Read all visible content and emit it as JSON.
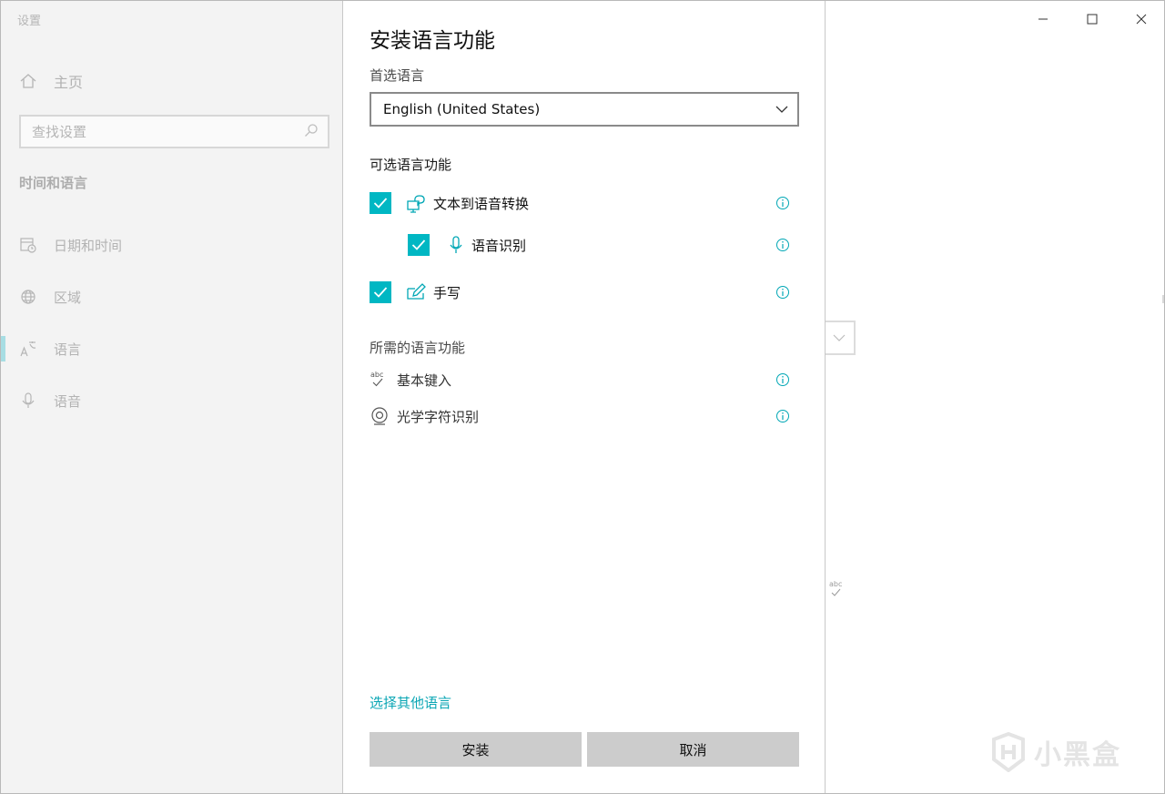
{
  "window": {
    "title": "设置"
  },
  "sidebar": {
    "home_label": "主页",
    "search_placeholder": "查找设置",
    "section_title": "时间和语言",
    "items": [
      {
        "label": "日期和时间",
        "icon": "calendar-clock-icon"
      },
      {
        "label": "区域",
        "icon": "globe-icon"
      },
      {
        "label": "语言",
        "icon": "language-icon",
        "active": true
      },
      {
        "label": "语音",
        "icon": "microphone-icon"
      }
    ]
  },
  "dialog": {
    "title": "安装语言功能",
    "preferred_label": "首选语言",
    "selected_language": "English (United States)",
    "optional_title": "可选语言功能",
    "optional_features": [
      {
        "label": "文本到语音转换",
        "checked": true,
        "icon": "text-to-speech-icon"
      },
      {
        "label": "语音识别",
        "checked": true,
        "icon": "microphone-icon"
      },
      {
        "label": "手写",
        "checked": true,
        "icon": "handwriting-icon"
      }
    ],
    "required_title": "所需的语言功能",
    "required_features": [
      {
        "label": "基本键入",
        "icon": "spellcheck-icon"
      },
      {
        "label": "光学字符识别",
        "icon": "ocr-camera-icon"
      }
    ],
    "other_language_link": "选择其他语言",
    "install_button": "安装",
    "cancel_button": "取消"
  },
  "colors": {
    "accent": "#00b7c3",
    "link": "#0aa6b4",
    "button_bg": "#cccccc"
  },
  "watermark": "小黑盒"
}
